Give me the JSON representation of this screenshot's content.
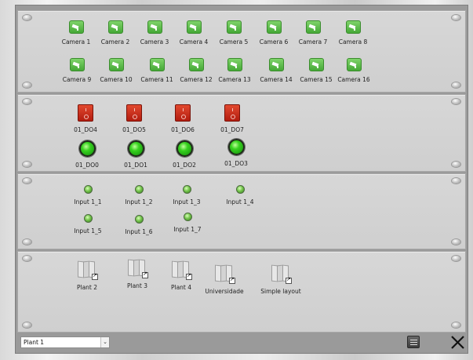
{
  "cameras": [
    {
      "label": "Camera 1"
    },
    {
      "label": "Camera 2"
    },
    {
      "label": "Camera 3"
    },
    {
      "label": "Camera 4"
    },
    {
      "label": "Camera 5"
    },
    {
      "label": "Camera 6"
    },
    {
      "label": "Camera 7"
    },
    {
      "label": "Camera 8"
    },
    {
      "label": "Camera 9"
    },
    {
      "label": "Camera 10"
    },
    {
      "label": "Camera 11"
    },
    {
      "label": "Camera 12"
    },
    {
      "label": "Camera 13"
    },
    {
      "label": "Camera 14"
    },
    {
      "label": "Camera 15"
    },
    {
      "label": "Camera 16"
    }
  ],
  "digital_outputs": {
    "switches": [
      {
        "label": "01_DO4"
      },
      {
        "label": "01_DO5"
      },
      {
        "label": "01_DO6"
      },
      {
        "label": "01_DO7"
      }
    ],
    "leds": [
      {
        "label": "01_DO0"
      },
      {
        "label": "01_DO1"
      },
      {
        "label": "01_DO2"
      },
      {
        "label": "01_DO3"
      }
    ]
  },
  "inputs": [
    {
      "label": "Input 1_1"
    },
    {
      "label": "Input 1_2"
    },
    {
      "label": "Input 1_3"
    },
    {
      "label": "Input 1_4"
    },
    {
      "label": "Input 1_5"
    },
    {
      "label": "Input 1_6"
    },
    {
      "label": "Input 1_7"
    }
  ],
  "plants": [
    {
      "label": "Plant 2"
    },
    {
      "label": "Plant 3"
    },
    {
      "label": "Plant 4"
    },
    {
      "label": "Universidade"
    },
    {
      "label": "Simple layout"
    }
  ],
  "bottom": {
    "plant_select": "Plant 1",
    "select_arrow": "⌄"
  },
  "colors": {
    "camera_green": "#45a836",
    "switch_red": "#c8261a",
    "led_green": "#37d21f"
  },
  "icons": {
    "camera": "camera-icon",
    "switch": "switch-icon",
    "led": "led-icon",
    "map": "map-icon",
    "notes": "notes-icon",
    "close": "close-icon"
  }
}
